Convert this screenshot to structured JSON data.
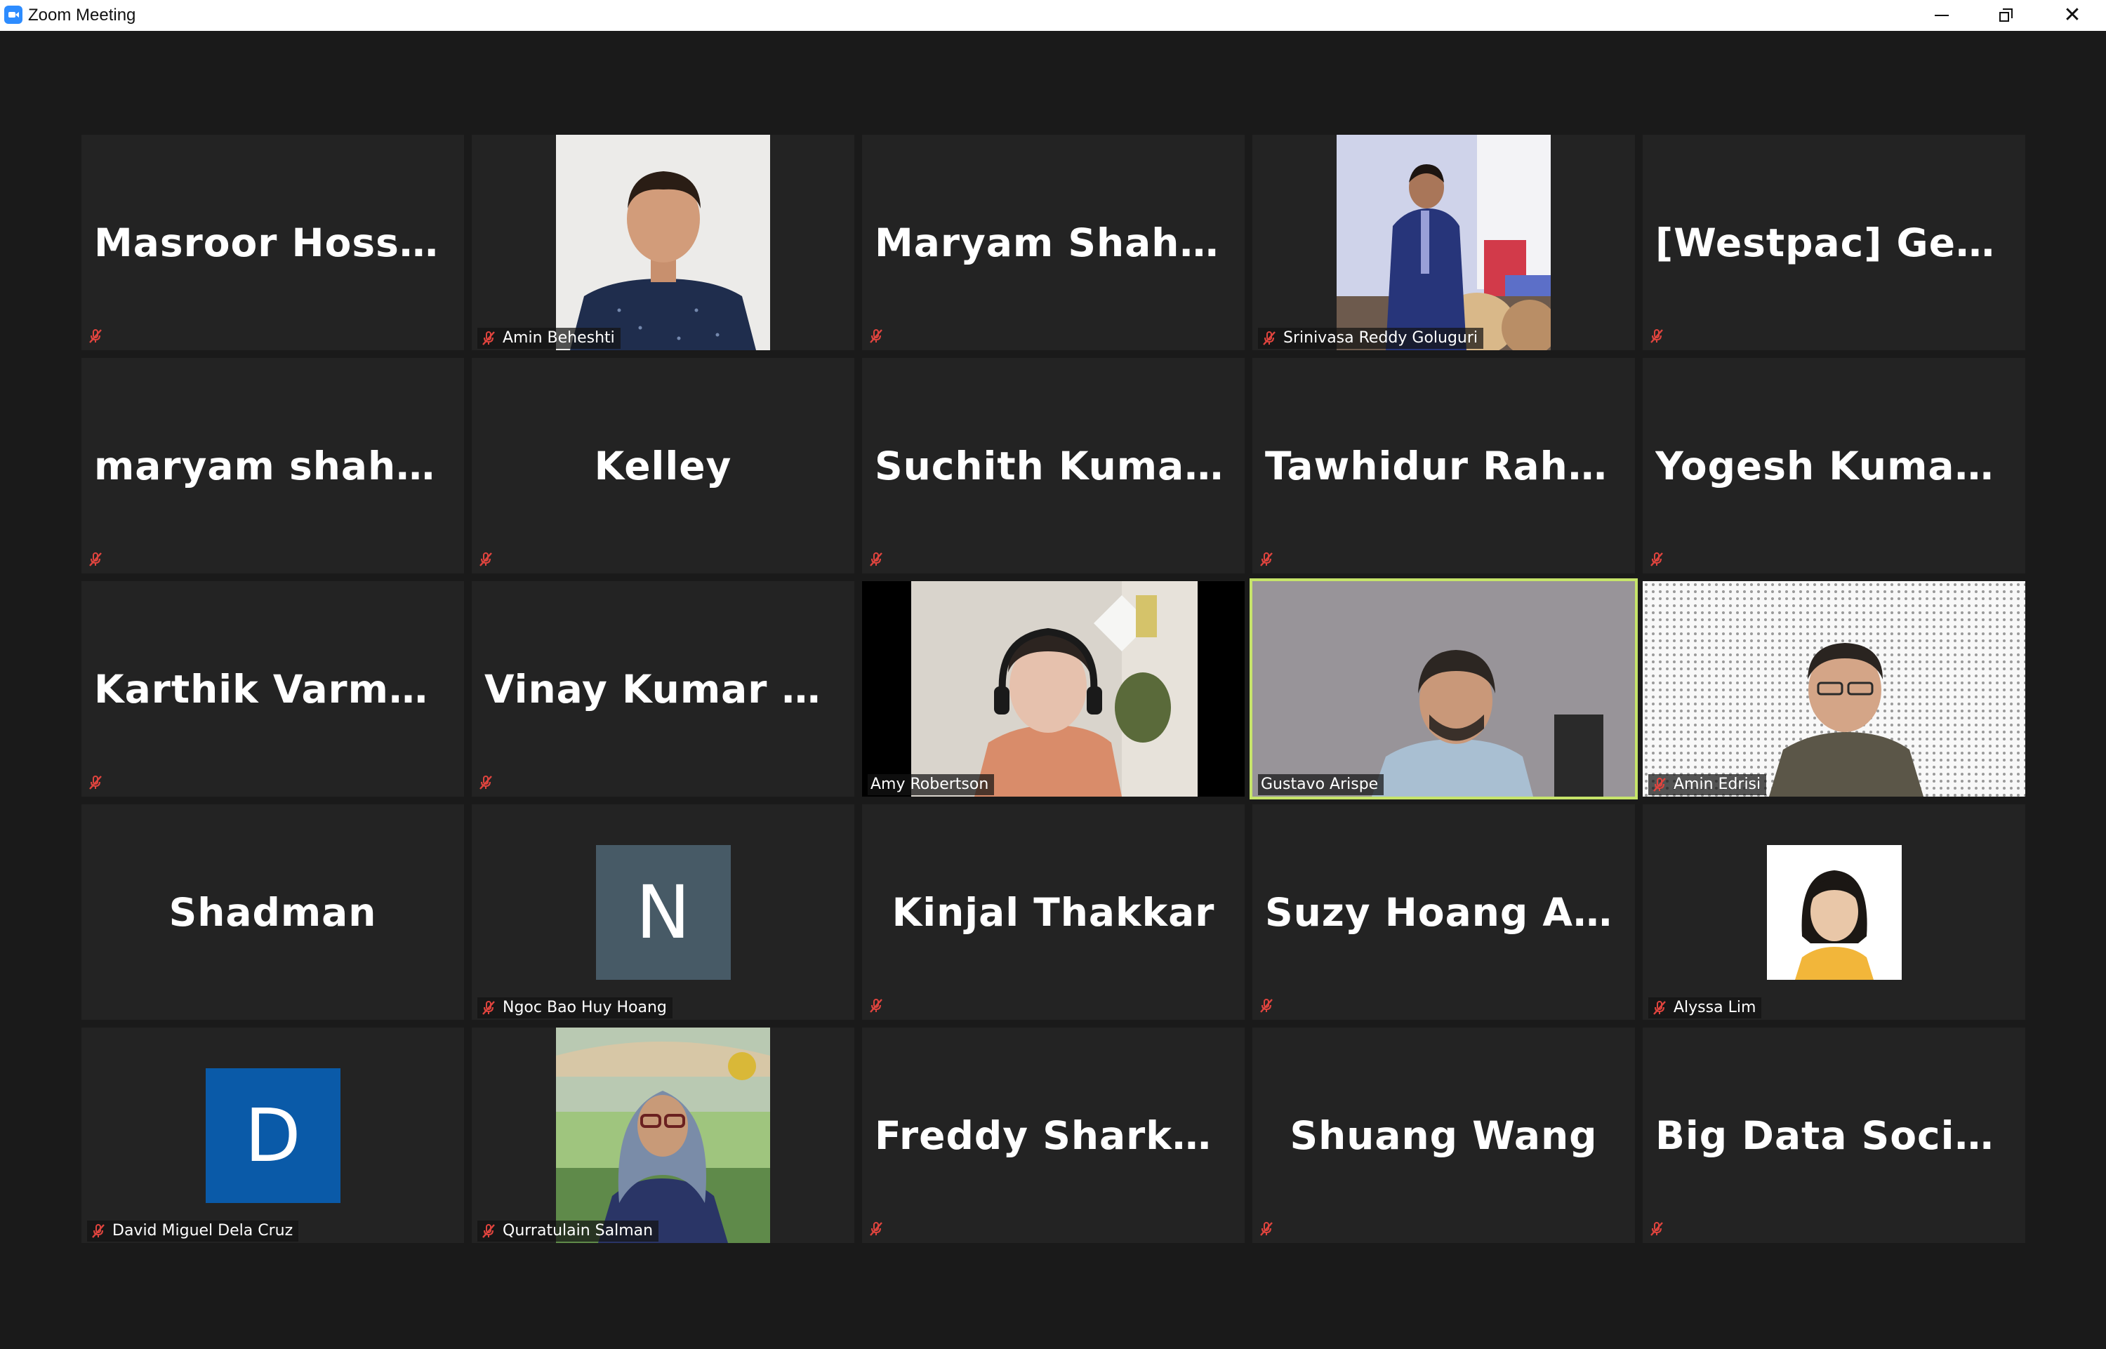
{
  "window": {
    "title": "Zoom Meeting",
    "controls": {
      "minimize": "minimize",
      "restore": "restore",
      "close": "close"
    }
  },
  "colors": {
    "background": "#1a1a1a",
    "tile": "#232323",
    "active_speaker_border": "#c6e46a",
    "muted_mic": "#e0443e",
    "avatar_n": "#475a66",
    "avatar_d": "#0a5aa8"
  },
  "participants": [
    {
      "display_name": "Masroor Hossain",
      "label": "",
      "muted": true,
      "view": "name"
    },
    {
      "display_name": "",
      "label": "Amin Beheshti",
      "muted": true,
      "view": "video"
    },
    {
      "display_name": "Maryam  Shahpa...",
      "label": "",
      "muted": true,
      "view": "name"
    },
    {
      "display_name": "",
      "label": "Srinivasa Reddy Goluguri",
      "muted": true,
      "view": "video"
    },
    {
      "display_name": "[Westpac]  Gethr...",
      "label": "",
      "muted": true,
      "view": "name"
    },
    {
      "display_name": "maryam  shahpa...",
      "label": "",
      "muted": true,
      "view": "name"
    },
    {
      "display_name": "Kelley",
      "label": "",
      "muted": true,
      "view": "name"
    },
    {
      "display_name": "Suchith  Kumar  S...",
      "label": "",
      "muted": true,
      "view": "name"
    },
    {
      "display_name": "Tawhidur  Rahma...",
      "label": "",
      "muted": true,
      "view": "name"
    },
    {
      "display_name": "Yogesh Kumar P A",
      "label": "",
      "muted": true,
      "view": "name"
    },
    {
      "display_name": "Karthik  Varma  K...",
      "label": "",
      "muted": true,
      "view": "name"
    },
    {
      "display_name": "Vinay  Kumar  Re...",
      "label": "",
      "muted": true,
      "view": "name"
    },
    {
      "display_name": "",
      "label": "Amy Robertson",
      "muted": false,
      "view": "video"
    },
    {
      "display_name": "",
      "label": "Gustavo Arispe",
      "muted": false,
      "view": "video",
      "active": true
    },
    {
      "display_name": "",
      "label": "Amin Edrisi",
      "muted": true,
      "view": "video"
    },
    {
      "display_name": "Shadman",
      "label": "",
      "muted": false,
      "view": "name"
    },
    {
      "display_name": "",
      "label": "Ngoc Bao Huy Hoang",
      "muted": true,
      "view": "avatar",
      "avatar_letter": "N"
    },
    {
      "display_name": "Kinjal Thakkar",
      "label": "",
      "muted": true,
      "view": "name"
    },
    {
      "display_name": "Suzy  Hoang  Anh...",
      "label": "",
      "muted": true,
      "view": "name"
    },
    {
      "display_name": "",
      "label": "Alyssa Lim",
      "muted": true,
      "view": "photo"
    },
    {
      "display_name": "",
      "label": "David Miguel Dela Cruz",
      "muted": true,
      "view": "avatar",
      "avatar_letter": "D"
    },
    {
      "display_name": "",
      "label": "Qurratulain Salman",
      "muted": true,
      "view": "photo"
    },
    {
      "display_name": "Freddy Sharkawy",
      "label": "",
      "muted": true,
      "view": "name"
    },
    {
      "display_name": "Shuang Wang",
      "label": "",
      "muted": true,
      "view": "name"
    },
    {
      "display_name": "Big Data Society",
      "label": "",
      "muted": true,
      "view": "name"
    }
  ]
}
